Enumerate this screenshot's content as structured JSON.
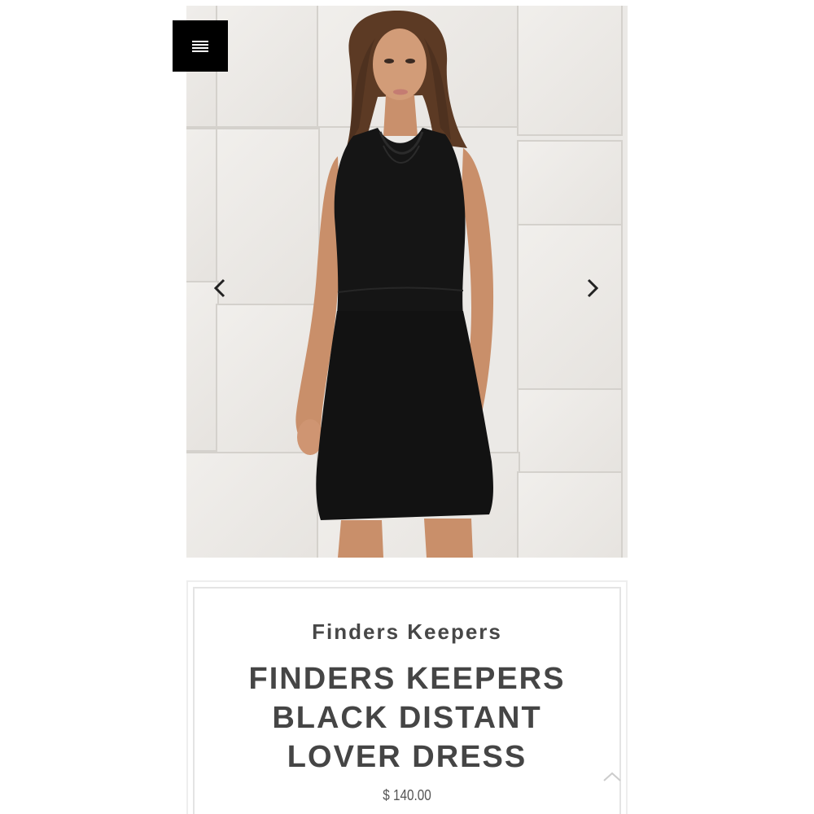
{
  "menu": {
    "icon": "hamburger-menu-icon"
  },
  "carousel": {
    "image": "product-photo-woman-in-black-halter-dress",
    "prev_icon": "chevron-left-icon",
    "next_icon": "chevron-right-icon"
  },
  "product": {
    "brand": "Finders Keepers",
    "title": "FINDERS KEEPERS BLACK DISTANT LOVER DRESS",
    "price": "$ 140.00"
  },
  "scroll_top": {
    "icon": "chevron-up-icon"
  },
  "colors": {
    "menu_background": "#000000",
    "text": "#454545",
    "card_border": "#e4e4e4",
    "dress": "#141414"
  }
}
